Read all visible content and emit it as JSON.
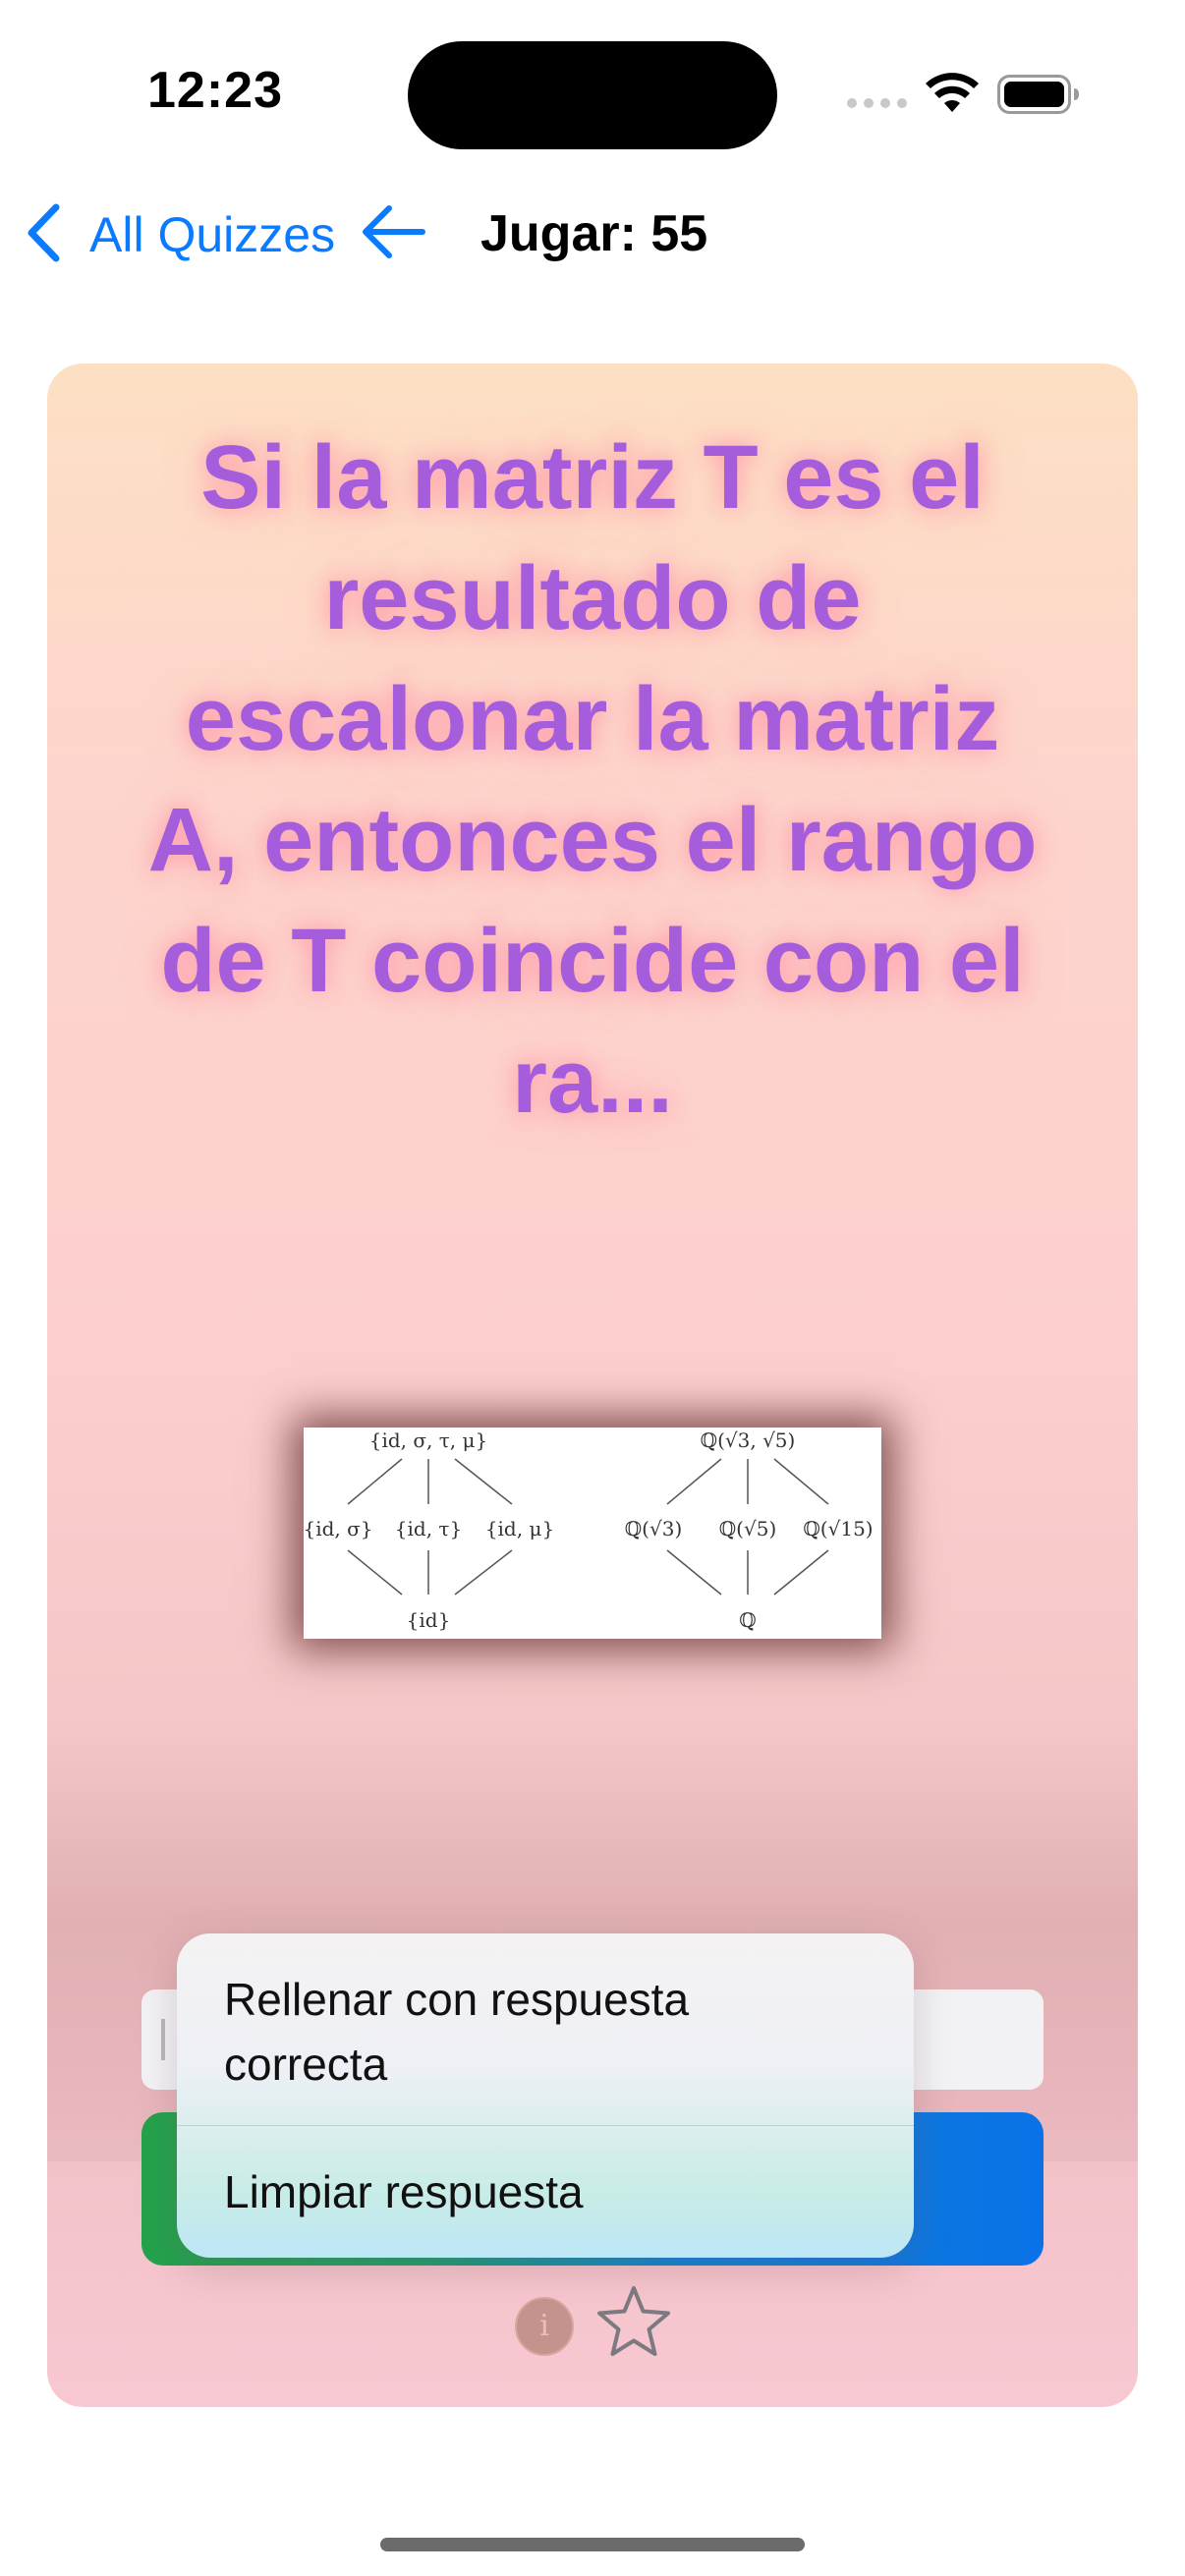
{
  "status_bar": {
    "time": "12:23"
  },
  "nav": {
    "back_label": "All Quizzes",
    "title": "Jugar: 55"
  },
  "quiz": {
    "question": "Si la matriz T es el resultado de escalonar la matriz A, entonces el rango de T coincide con el ra...",
    "diagram_labels": {
      "left_top": "{id, σ, τ, μ}",
      "left_mid_1": "{id, σ}",
      "left_mid_2": "{id, τ}",
      "left_mid_3": "{id, μ}",
      "left_bottom": "{id}",
      "right_top": "ℚ(√3, √5)",
      "right_mid_1": "ℚ(√3)",
      "right_mid_2": "ℚ(√5)",
      "right_mid_3": "ℚ(√15)",
      "right_bottom": "ℚ"
    }
  },
  "context_menu": {
    "items": [
      {
        "label": "Rellenar con respuesta correcta"
      },
      {
        "label": "Limpiar respuesta"
      }
    ]
  },
  "colors": {
    "accent": "#0a7aff",
    "question_text": "#a65ddb"
  },
  "icons": [
    "chevron-left-icon",
    "arrow-left-icon",
    "wifi-icon",
    "battery-icon",
    "info-icon",
    "star-icon"
  ]
}
